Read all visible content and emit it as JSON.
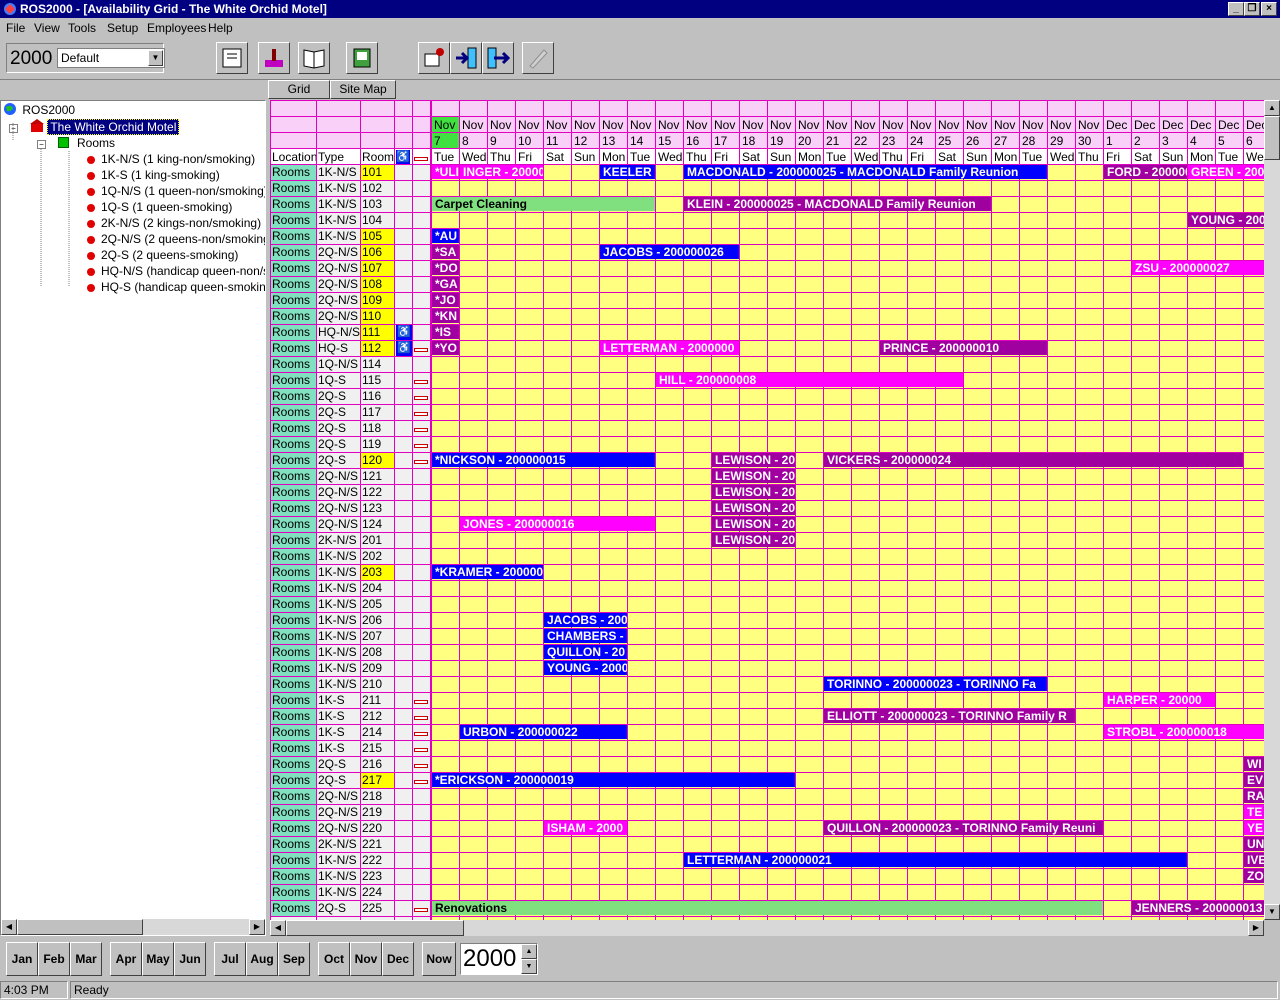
{
  "window": {
    "title": "ROS2000 - [Availability Grid - The White Orchid Motel]"
  },
  "menu": [
    "File",
    "View",
    "Tools",
    "Setup",
    "Employees",
    "Help"
  ],
  "toolbar": {
    "year": "2000",
    "view_select": "Default"
  },
  "tabs": [
    "Grid",
    "Site Map"
  ],
  "tree": {
    "root": "ROS2000",
    "hotel": "The White Orchid Motel",
    "rooms": "Rooms",
    "types": [
      "1K-N/S (1 king-non/smoking)",
      "1K-S (1 king-smoking)",
      "1Q-N/S (1 queen-non/smoking)",
      "1Q-S (1 queen-smoking)",
      "2K-N/S (2 kings-non/smoking)",
      "2Q-N/S (2 queens-non/smoking)",
      "2Q-S (2 queens-smoking)",
      "HQ-N/S (handicap queen-non/smoking)",
      "HQ-S (handicap queen-smoking)"
    ]
  },
  "colors": {
    "grid_bg": "#ffff80",
    "grid_line": "#e000c0",
    "blue": "#0000ff",
    "purple": "#a000a0",
    "magenta": "#ff00ff",
    "green": "#80e080",
    "room_highlight": "#ffff00",
    "handicap": "#0000ff",
    "location": "#80e0c0",
    "today": "#40e040"
  },
  "grid": {
    "col_headers": [
      "Location",
      "Type",
      "Room"
    ],
    "month_row": [
      "Nov",
      "Nov",
      "Nov",
      "Nov",
      "Nov",
      "Nov",
      "Nov",
      "Nov",
      "Nov",
      "Nov",
      "Nov",
      "Nov",
      "Nov",
      "Nov",
      "Nov",
      "Nov",
      "Nov",
      "Nov",
      "Nov",
      "Nov",
      "Nov",
      "Nov",
      "Nov",
      "Nov",
      "Dec",
      "Dec",
      "Dec",
      "Dec",
      "Dec",
      "Dec"
    ],
    "day_row": [
      "7",
      "8",
      "9",
      "10",
      "11",
      "12",
      "13",
      "14",
      "15",
      "16",
      "17",
      "18",
      "19",
      "20",
      "21",
      "22",
      "23",
      "24",
      "25",
      "26",
      "27",
      "28",
      "29",
      "30",
      "1",
      "2",
      "3",
      "4",
      "5",
      "6"
    ],
    "dow_row": [
      "Tue",
      "Wed",
      "Thu",
      "Fri",
      "Sat",
      "Sun",
      "Mon",
      "Tue",
      "Wed",
      "Thu",
      "Fri",
      "Sat",
      "Sun",
      "Mon",
      "Tue",
      "Wed",
      "Thu",
      "Fri",
      "Sat",
      "Sun",
      "Mon",
      "Tue",
      "Wed",
      "Thu",
      "Fri",
      "Sat",
      "Sun",
      "Mon",
      "Tue",
      "Wed"
    ],
    "rows": [
      {
        "loc": "Rooms",
        "type": "1K-N/S",
        "room": "101",
        "hl": true
      },
      {
        "loc": "Rooms",
        "type": "1K-N/S",
        "room": "102"
      },
      {
        "loc": "Rooms",
        "type": "1K-N/S",
        "room": "103"
      },
      {
        "loc": "Rooms",
        "type": "1K-N/S",
        "room": "104"
      },
      {
        "loc": "Rooms",
        "type": "1K-N/S",
        "room": "105",
        "hl": true
      },
      {
        "loc": "Rooms",
        "type": "2Q-N/S",
        "room": "106",
        "hl": true
      },
      {
        "loc": "Rooms",
        "type": "2Q-N/S",
        "room": "107",
        "hl": true
      },
      {
        "loc": "Rooms",
        "type": "2Q-N/S",
        "room": "108",
        "hl": true
      },
      {
        "loc": "Rooms",
        "type": "2Q-N/S",
        "room": "109",
        "hl": true
      },
      {
        "loc": "Rooms",
        "type": "2Q-N/S",
        "room": "110",
        "hl": true
      },
      {
        "loc": "Rooms",
        "type": "HQ-N/S",
        "room": "111",
        "hl": true,
        "hc": true
      },
      {
        "loc": "Rooms",
        "type": "HQ-S",
        "room": "112",
        "hl": true,
        "hc": true,
        "sm": true
      },
      {
        "loc": "Rooms",
        "type": "1Q-N/S",
        "room": "114"
      },
      {
        "loc": "Rooms",
        "type": "1Q-S",
        "room": "115",
        "sm": true
      },
      {
        "loc": "Rooms",
        "type": "2Q-S",
        "room": "116",
        "sm": true
      },
      {
        "loc": "Rooms",
        "type": "2Q-S",
        "room": "117",
        "sm": true
      },
      {
        "loc": "Rooms",
        "type": "2Q-S",
        "room": "118",
        "sm": true
      },
      {
        "loc": "Rooms",
        "type": "2Q-S",
        "room": "119",
        "sm": true
      },
      {
        "loc": "Rooms",
        "type": "2Q-S",
        "room": "120",
        "hl": true,
        "sm": true
      },
      {
        "loc": "Rooms",
        "type": "2Q-N/S",
        "room": "121"
      },
      {
        "loc": "Rooms",
        "type": "2Q-N/S",
        "room": "122"
      },
      {
        "loc": "Rooms",
        "type": "2Q-N/S",
        "room": "123"
      },
      {
        "loc": "Rooms",
        "type": "2Q-N/S",
        "room": "124"
      },
      {
        "loc": "Rooms",
        "type": "2K-N/S",
        "room": "201"
      },
      {
        "loc": "Rooms",
        "type": "1K-N/S",
        "room": "202"
      },
      {
        "loc": "Rooms",
        "type": "1K-N/S",
        "room": "203",
        "hl": true
      },
      {
        "loc": "Rooms",
        "type": "1K-N/S",
        "room": "204"
      },
      {
        "loc": "Rooms",
        "type": "1K-N/S",
        "room": "205"
      },
      {
        "loc": "Rooms",
        "type": "1K-N/S",
        "room": "206"
      },
      {
        "loc": "Rooms",
        "type": "1K-N/S",
        "room": "207"
      },
      {
        "loc": "Rooms",
        "type": "1K-N/S",
        "room": "208"
      },
      {
        "loc": "Rooms",
        "type": "1K-N/S",
        "room": "209"
      },
      {
        "loc": "Rooms",
        "type": "1K-N/S",
        "room": "210"
      },
      {
        "loc": "Rooms",
        "type": "1K-S",
        "room": "211",
        "sm": true
      },
      {
        "loc": "Rooms",
        "type": "1K-S",
        "room": "212",
        "sm": true
      },
      {
        "loc": "Rooms",
        "type": "1K-S",
        "room": "214",
        "sm": true
      },
      {
        "loc": "Rooms",
        "type": "1K-S",
        "room": "215",
        "sm": true
      },
      {
        "loc": "Rooms",
        "type": "2Q-S",
        "room": "216",
        "sm": true
      },
      {
        "loc": "Rooms",
        "type": "2Q-S",
        "room": "217",
        "hl": true,
        "sm": true
      },
      {
        "loc": "Rooms",
        "type": "2Q-N/S",
        "room": "218"
      },
      {
        "loc": "Rooms",
        "type": "2Q-N/S",
        "room": "219"
      },
      {
        "loc": "Rooms",
        "type": "2Q-N/S",
        "room": "220"
      },
      {
        "loc": "Rooms",
        "type": "2K-N/S",
        "room": "221"
      },
      {
        "loc": "Rooms",
        "type": "1K-N/S",
        "room": "222"
      },
      {
        "loc": "Rooms",
        "type": "1K-N/S",
        "room": "223"
      },
      {
        "loc": "Rooms",
        "type": "1K-N/S",
        "room": "224"
      },
      {
        "loc": "Rooms",
        "type": "2Q-S",
        "room": "225",
        "sm": true
      }
    ],
    "bookings": [
      {
        "row": 0,
        "start": 0,
        "end": 1,
        "text": "*ULI",
        "color": "magenta"
      },
      {
        "row": 0,
        "start": 1,
        "end": 4,
        "text": "INGER - 20000000",
        "color": "magenta"
      },
      {
        "row": 0,
        "start": 6,
        "end": 8,
        "text": "KEELER",
        "color": "blue"
      },
      {
        "row": 0,
        "start": 9,
        "end": 22,
        "text": "MACDONALD - 200000025 - MACDONALD Family Reunion",
        "color": "blue"
      },
      {
        "row": 0,
        "start": 24,
        "end": 27,
        "text": "FORD - 200000",
        "color": "purple"
      },
      {
        "row": 0,
        "start": 27,
        "end": 30,
        "text": "GREEN - 200",
        "color": "magenta"
      },
      {
        "row": 2,
        "start": 0,
        "end": 8,
        "text": "Carpet Cleaning",
        "color": "green"
      },
      {
        "row": 2,
        "start": 9,
        "end": 20,
        "text": "KLEIN - 200000025 - MACDONALD Family Reunion",
        "color": "purple"
      },
      {
        "row": 3,
        "start": 27,
        "end": 30,
        "text": "YOUNG - 200",
        "color": "purple"
      },
      {
        "row": 4,
        "start": 0,
        "end": 1,
        "text": "*AU",
        "color": "blue"
      },
      {
        "row": 5,
        "start": 0,
        "end": 1,
        "text": "*SA",
        "color": "purple"
      },
      {
        "row": 5,
        "start": 6,
        "end": 11,
        "text": "JACOBS - 200000026",
        "color": "blue"
      },
      {
        "row": 6,
        "start": 0,
        "end": 1,
        "text": "*DO",
        "color": "purple"
      },
      {
        "row": 6,
        "start": 25,
        "end": 30,
        "text": "ZSU - 200000027",
        "color": "magenta"
      },
      {
        "row": 7,
        "start": 0,
        "end": 1,
        "text": "*GA",
        "color": "purple"
      },
      {
        "row": 8,
        "start": 0,
        "end": 1,
        "text": "*JO",
        "color": "purple"
      },
      {
        "row": 9,
        "start": 0,
        "end": 1,
        "text": "*KN",
        "color": "purple"
      },
      {
        "row": 10,
        "start": 0,
        "end": 1,
        "text": "*IS",
        "color": "purple"
      },
      {
        "row": 11,
        "start": 0,
        "end": 1,
        "text": "*YO",
        "color": "purple"
      },
      {
        "row": 11,
        "start": 6,
        "end": 11,
        "text": "LETTERMAN - 2000000",
        "color": "magenta"
      },
      {
        "row": 11,
        "start": 16,
        "end": 22,
        "text": "PRINCE - 200000010",
        "color": "purple"
      },
      {
        "row": 13,
        "start": 8,
        "end": 19,
        "text": "HILL - 200000008",
        "color": "magenta"
      },
      {
        "row": 18,
        "start": 0,
        "end": 8,
        "text": "*NICKSON - 200000015",
        "color": "blue"
      },
      {
        "row": 18,
        "start": 10,
        "end": 13,
        "text": "LEWISON - 20",
        "color": "purple"
      },
      {
        "row": 18,
        "start": 14,
        "end": 29,
        "text": "VICKERS - 200000024",
        "color": "purple"
      },
      {
        "row": 19,
        "start": 10,
        "end": 13,
        "text": "LEWISON - 20",
        "color": "purple"
      },
      {
        "row": 20,
        "start": 10,
        "end": 13,
        "text": "LEWISON - 20",
        "color": "purple"
      },
      {
        "row": 21,
        "start": 10,
        "end": 13,
        "text": "LEWISON - 20",
        "color": "purple"
      },
      {
        "row": 22,
        "start": 1,
        "end": 8,
        "text": "JONES - 200000016",
        "color": "magenta"
      },
      {
        "row": 22,
        "start": 10,
        "end": 13,
        "text": "LEWISON - 20",
        "color": "purple"
      },
      {
        "row": 23,
        "start": 10,
        "end": 13,
        "text": "LEWISON - 20",
        "color": "purple"
      },
      {
        "row": 25,
        "start": 0,
        "end": 4,
        "text": "*KRAMER - 200000",
        "color": "blue"
      },
      {
        "row": 28,
        "start": 4,
        "end": 7,
        "text": "JACOBS - 200",
        "color": "blue"
      },
      {
        "row": 29,
        "start": 4,
        "end": 7,
        "text": "CHAMBERS -",
        "color": "blue"
      },
      {
        "row": 30,
        "start": 4,
        "end": 7,
        "text": "QUILLON - 20",
        "color": "blue"
      },
      {
        "row": 31,
        "start": 4,
        "end": 7,
        "text": "YOUNG - 2000",
        "color": "blue"
      },
      {
        "row": 32,
        "start": 14,
        "end": 22,
        "text": "TORINNO - 200000023 - TORINNO Fa",
        "color": "blue"
      },
      {
        "row": 33,
        "start": 24,
        "end": 28,
        "text": "HARPER - 20000",
        "color": "magenta"
      },
      {
        "row": 34,
        "start": 14,
        "end": 23,
        "text": "ELLIOTT - 200000023 - TORINNO Family R",
        "color": "purple"
      },
      {
        "row": 35,
        "start": 1,
        "end": 7,
        "text": "URBON - 200000022",
        "color": "blue"
      },
      {
        "row": 35,
        "start": 24,
        "end": 30,
        "text": "STROBL - 200000018",
        "color": "magenta"
      },
      {
        "row": 37,
        "start": 29,
        "end": 30,
        "text": "WI",
        "color": "purple"
      },
      {
        "row": 38,
        "start": 0,
        "end": 13,
        "text": "*ERICKSON - 200000019",
        "color": "blue"
      },
      {
        "row": 38,
        "start": 29,
        "end": 30,
        "text": "EV",
        "color": "purple"
      },
      {
        "row": 39,
        "start": 29,
        "end": 30,
        "text": "RA",
        "color": "purple"
      },
      {
        "row": 40,
        "start": 29,
        "end": 30,
        "text": "TE",
        "color": "magenta"
      },
      {
        "row": 41,
        "start": 4,
        "end": 7,
        "text": "ISHAM - 2000",
        "color": "magenta"
      },
      {
        "row": 41,
        "start": 14,
        "end": 24,
        "text": "QUILLON - 200000023 - TORINNO Family Reuni",
        "color": "purple"
      },
      {
        "row": 41,
        "start": 29,
        "end": 30,
        "text": "YE",
        "color": "magenta"
      },
      {
        "row": 42,
        "start": 29,
        "end": 30,
        "text": "UN",
        "color": "purple"
      },
      {
        "row": 43,
        "start": 9,
        "end": 27,
        "text": "LETTERMAN - 200000021",
        "color": "blue"
      },
      {
        "row": 43,
        "start": 29,
        "end": 30,
        "text": "IVE",
        "color": "purple"
      },
      {
        "row": 44,
        "start": 29,
        "end": 30,
        "text": "ZO",
        "color": "purple"
      },
      {
        "row": 46,
        "start": 0,
        "end": 24,
        "text": "Renovations",
        "color": "green"
      },
      {
        "row": 46,
        "start": 25,
        "end": 30,
        "text": "JENNERS - 200000013",
        "color": "purple"
      }
    ]
  },
  "months": [
    "Jan",
    "Feb",
    "Mar",
    "Apr",
    "May",
    "Jun",
    "Jul",
    "Aug",
    "Sep",
    "Oct",
    "Nov",
    "Dec"
  ],
  "now_label": "Now",
  "year_spinner": "2000",
  "status": {
    "time": "4:03 PM",
    "text": "Ready"
  }
}
